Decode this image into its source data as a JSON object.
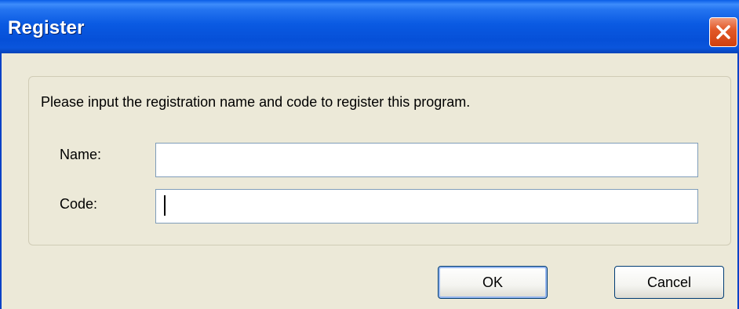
{
  "window": {
    "title": "Register"
  },
  "dialog": {
    "prompt": "Please input the registration name and code to register this program.",
    "name_label": "Name:",
    "name_value": "",
    "code_label": "Code:",
    "code_value": ""
  },
  "buttons": {
    "ok_label": "OK",
    "cancel_label": "Cancel"
  },
  "colors": {
    "titlebar": "#0a5ae2",
    "close_button": "#e25a2a",
    "dialog_background": "#ece9d8"
  },
  "icons": {
    "close": "close-icon"
  }
}
